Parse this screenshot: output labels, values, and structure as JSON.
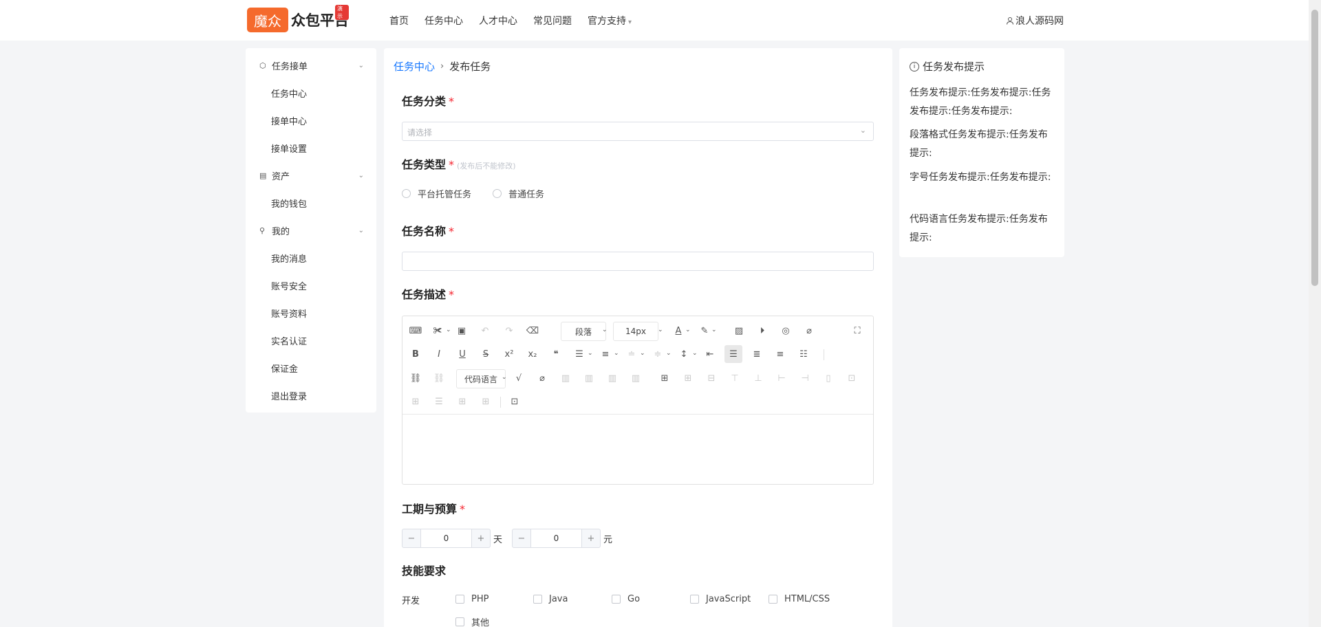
{
  "header": {
    "logo_mark": "魔众",
    "logo_text": "众包平台",
    "logo_badge": "演示",
    "nav": [
      "首页",
      "任务中心",
      "人才中心",
      "常见问题",
      "官方支持"
    ],
    "user_name": "浪人源码网"
  },
  "sidebar": {
    "groups": [
      {
        "label": "任务接单",
        "icon": "cube-icon",
        "items": [
          "任务中心",
          "接单中心",
          "接单设置"
        ]
      },
      {
        "label": "资产",
        "icon": "wallet-icon",
        "items": [
          "我的钱包"
        ]
      },
      {
        "label": "我的",
        "icon": "user-icon",
        "items": [
          "我的消息",
          "账号安全",
          "账号资料",
          "实名认证",
          "保证金",
          "退出登录"
        ]
      }
    ]
  },
  "breadcrumb": {
    "parent": "任务中心",
    "current": "发布任务"
  },
  "form": {
    "category": {
      "label": "任务分类",
      "required": "*",
      "placeholder": "请选择"
    },
    "type": {
      "label": "任务类型",
      "required": "*",
      "hint": "(发布后不能修改)",
      "options": [
        "平台托管任务",
        "普通任务"
      ]
    },
    "name": {
      "label": "任务名称",
      "required": "*",
      "value": ""
    },
    "description": {
      "label": "任务描述",
      "required": "*",
      "paragraph_select": "段落",
      "font_size_select": "14px",
      "code_lang_select": "代码语言"
    },
    "schedule": {
      "label": "工期与预算",
      "required": "*",
      "days_value": "0",
      "days_unit": "天",
      "budget_value": "0",
      "budget_unit": "元",
      "minus": "−",
      "plus": "+"
    },
    "skills": {
      "label": "技能要求",
      "category": "开发",
      "options": [
        "PHP",
        "Java",
        "Go",
        "JavaScript",
        "HTML/CSS",
        "其他"
      ]
    }
  },
  "tips": {
    "title": "任务发布提示",
    "items": [
      "任务发布提示:任务发布提示:任务发布提示:任务发布提示:",
      "段落格式任务发布提示:任务发布提示:",
      "字号任务发布提示:任务发布提示:",
      "代码语言任务发布提示:任务发布提示:"
    ]
  },
  "colors": {
    "brand": "#f56a2c",
    "link": "#1677ff",
    "required": "#f5222d"
  }
}
